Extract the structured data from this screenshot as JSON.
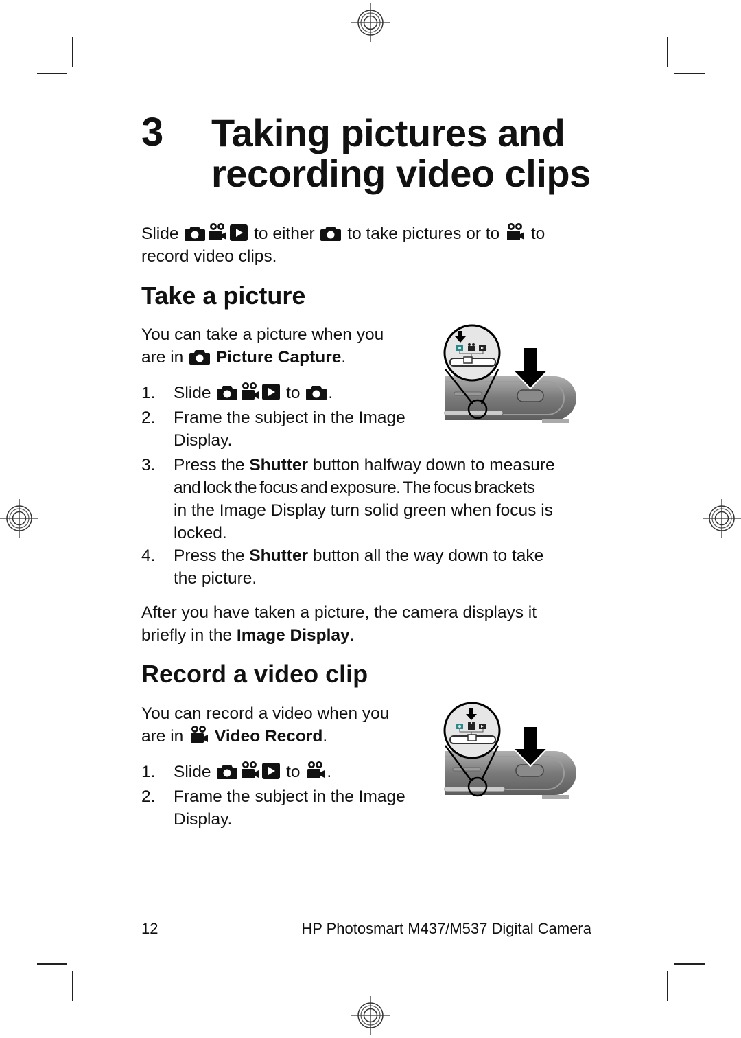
{
  "chapter": {
    "number": "3",
    "title_line1": "Taking pictures and",
    "title_line2": "recording video clips"
  },
  "intro": {
    "prefix": "Slide",
    "mid1": "to either",
    "mid2": "to take pictures or to",
    "mid3": "to",
    "line2": "record video clips."
  },
  "take_picture": {
    "heading": "Take a picture",
    "lead_line1": "You can take a picture when you",
    "lead_prefix": "are in",
    "mode_label": "Picture Capture",
    "lead_suffix": ".",
    "steps": [
      {
        "num": "1.",
        "prefix": "Slide",
        "mid": "to",
        "suffix": "."
      },
      {
        "num": "2.",
        "line1": "Frame the subject in the Image",
        "line2": "Display."
      },
      {
        "num": "3.",
        "pre": "Press the",
        "bold": "Shutter",
        "post": "button halfway down to measure",
        "line2": "and lock the focus and exposure. The focus brackets",
        "line3": "in the Image Display turn solid green when focus is",
        "line4": "locked."
      },
      {
        "num": "4.",
        "pre": "Press the",
        "bold": "Shutter",
        "post": "button all the way down to take",
        "line2": "the picture."
      }
    ],
    "after_line1": "After you have taken a picture, the camera displays it",
    "after_prefix": "briefly in the",
    "after_bold": "Image Display",
    "after_suffix": "."
  },
  "record_video": {
    "heading": "Record a video clip",
    "lead_line1": "You can record a video when you",
    "lead_prefix": "are in",
    "mode_label": "Video Record",
    "lead_suffix": ".",
    "steps": [
      {
        "num": "1.",
        "prefix": "Slide",
        "mid": "to",
        "suffix": "."
      },
      {
        "num": "2.",
        "line1": "Frame the subject in the Image",
        "line2": "Display."
      }
    ]
  },
  "icons": {
    "picture_mode": "camera-icon",
    "video_mode": "video-camera-icon",
    "playback_mode": "playback-icon"
  },
  "colors": {
    "text": "#111111",
    "highlight_teal": "#2a8a8a",
    "camera_body": "#8a8a8a"
  },
  "footer": {
    "page_number": "12",
    "product": "HP Photosmart M437/M537 Digital Camera"
  }
}
